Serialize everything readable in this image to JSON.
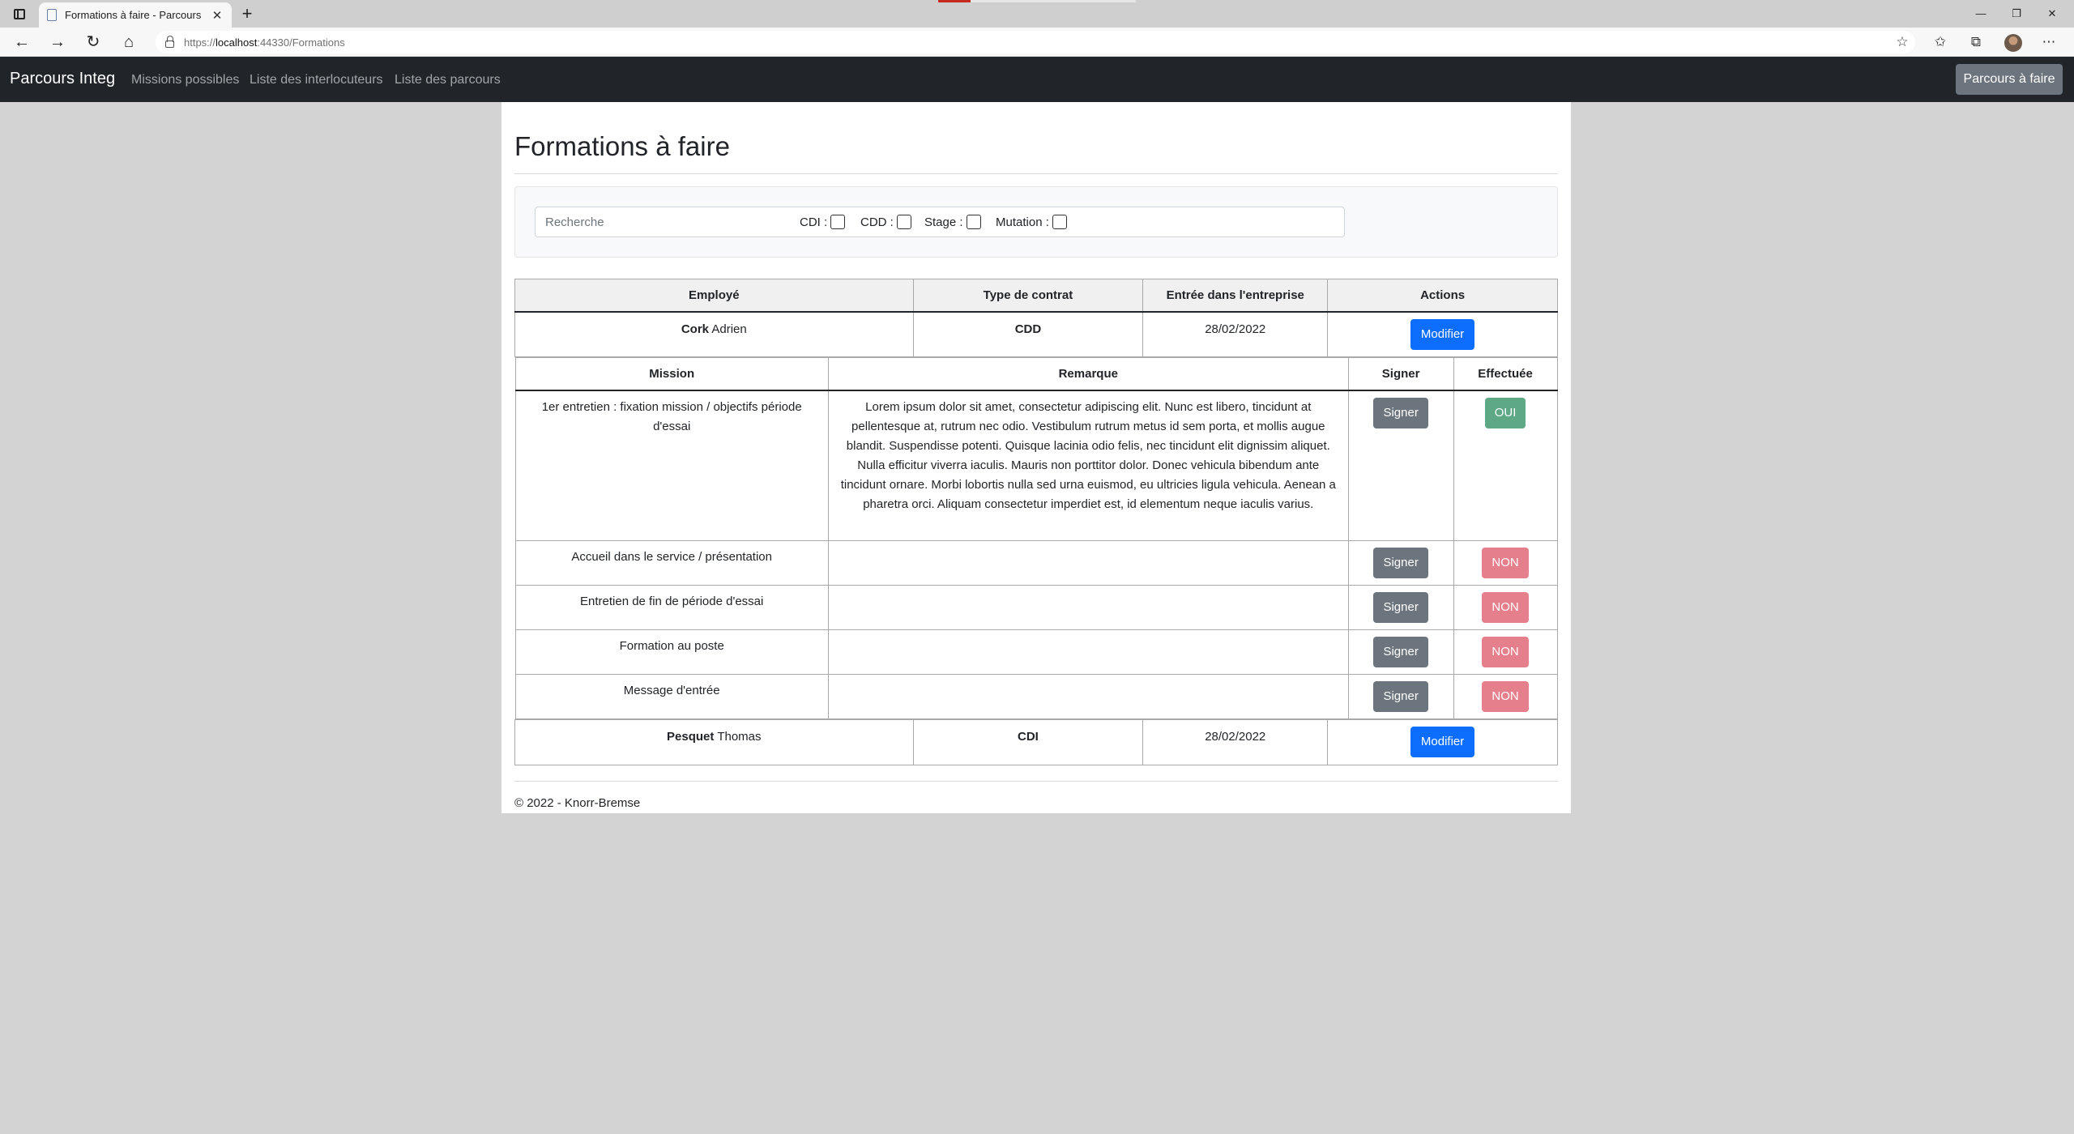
{
  "browser": {
    "tab_title": "Formations à faire - Parcours d'I",
    "tab_close": "✕",
    "new_tab": "+",
    "url_prefix": "https://",
    "url_host": "localhost",
    "url_rest": ":44330/Formations",
    "win_min": "—",
    "win_restore": "❐",
    "win_close": "✕"
  },
  "navbar": {
    "brand": "Parcours Integ",
    "links": [
      "Missions possibles",
      "Liste des interlocuteurs",
      "Liste des parcours"
    ],
    "right_button": "Parcours à faire"
  },
  "page": {
    "title": "Formations à faire",
    "search_placeholder": "Recherche",
    "filters": [
      "CDI :",
      "CDD :",
      "Stage :",
      "Mutation :"
    ]
  },
  "employees_table": {
    "headers": [
      "Employé",
      "Type de contrat",
      "Entrée dans l'entreprise",
      "Actions"
    ],
    "rows": [
      {
        "last_name": "Cork",
        "first_name": "Adrien",
        "contract": "CDD",
        "entry_date": "28/02/2022",
        "action": "Modifier"
      },
      {
        "last_name": "Pesquet",
        "first_name": "Thomas",
        "contract": "CDI",
        "entry_date": "28/02/2022",
        "action": "Modifier"
      }
    ]
  },
  "missions_table": {
    "headers": [
      "Mission",
      "Remarque",
      "Signer",
      "Effectuée"
    ],
    "rows": [
      {
        "mission": "1er entretien : fixation mission / objectifs période d'essai",
        "remark": "Lorem ipsum dolor sit amet, consectetur adipiscing elit. Nunc est libero, tincidunt at pellentesque at, rutrum nec odio. Vestibulum rutrum metus id sem porta, et mollis augue blandit. Suspendisse potenti. Quisque lacinia odio felis, nec tincidunt elit dignissim aliquet. Nulla efficitur viverra iaculis. Mauris non porttitor dolor. Donec vehicula bibendum ante tincidunt ornare. Morbi lobortis nulla sed urna euismod, eu ultricies ligula vehicula. Aenean a pharetra orci. Aliquam consectetur imperdiet est, id elementum neque iaculis varius.",
        "sign": "Signer",
        "done": "OUI"
      },
      {
        "mission": "Accueil dans le service / présentation",
        "remark": "",
        "sign": "Signer",
        "done": "NON"
      },
      {
        "mission": "Entretien de fin de période d'essai",
        "remark": "",
        "sign": "Signer",
        "done": "NON"
      },
      {
        "mission": "Formation au poste",
        "remark": "",
        "sign": "Signer",
        "done": "NON"
      },
      {
        "mission": "Message d'entrée",
        "remark": "",
        "sign": "Signer",
        "done": "NON"
      }
    ]
  },
  "footer": {
    "text": "© 2022 - Knorr-Bremse"
  },
  "colors": {
    "navbar": "#212529",
    "primary": "#0d6efd",
    "secondary": "#6c757d",
    "success_badge": "#5ea886",
    "danger_badge": "#e47f8b",
    "page_background": "#d3d3d3"
  }
}
